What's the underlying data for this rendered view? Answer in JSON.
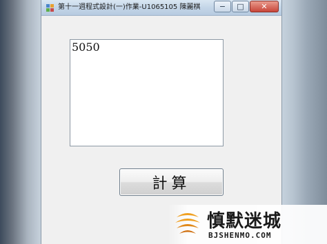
{
  "window": {
    "title": "第十一週程式設計(一)作業-U1065105 陳麗棋",
    "controls": {
      "minimize": "−",
      "maximize": "□",
      "close": "✕"
    }
  },
  "main": {
    "output_value": "5050",
    "calc_button_label": "計算"
  },
  "watermark": {
    "title": "慎默迷城",
    "url": "BJSHENMO.COM",
    "colors": {
      "orange": "#f0a020",
      "dark": "#1a1a1a"
    }
  },
  "icons": {
    "app": "app-icon",
    "logo": "brand-logo-icon"
  }
}
